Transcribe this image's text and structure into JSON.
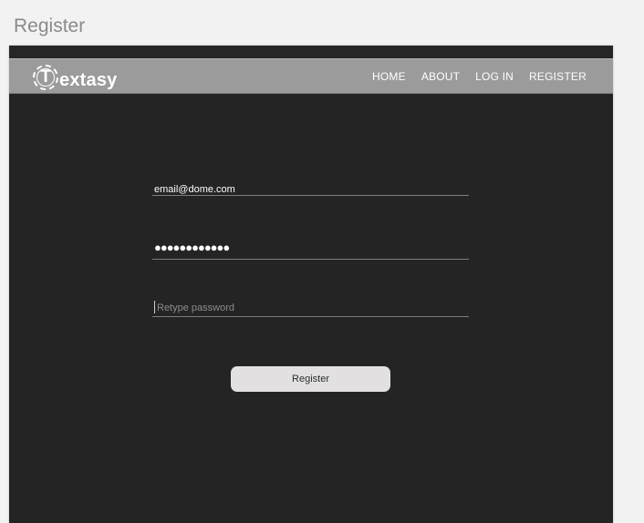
{
  "artboard": {
    "title": "Register"
  },
  "header": {
    "logo": {
      "mark": "T",
      "text": "extasy"
    },
    "nav": [
      {
        "label": "HOME"
      },
      {
        "label": "ABOUT"
      },
      {
        "label": "LOG IN"
      },
      {
        "label": "REGISTER"
      }
    ]
  },
  "form": {
    "email": {
      "value": "email@dome.com"
    },
    "password": {
      "masked": "●●●●●●●●●●●●"
    },
    "retype": {
      "placeholder": "Retype password",
      "value": ""
    },
    "submit_label": "Register"
  },
  "colors": {
    "page_bg": "#f2f2f2",
    "frame_bg": "#242424",
    "navbar_bg": "#9b9b9b",
    "button_bg": "#e2e0e0",
    "text_light": "#ffffff"
  }
}
